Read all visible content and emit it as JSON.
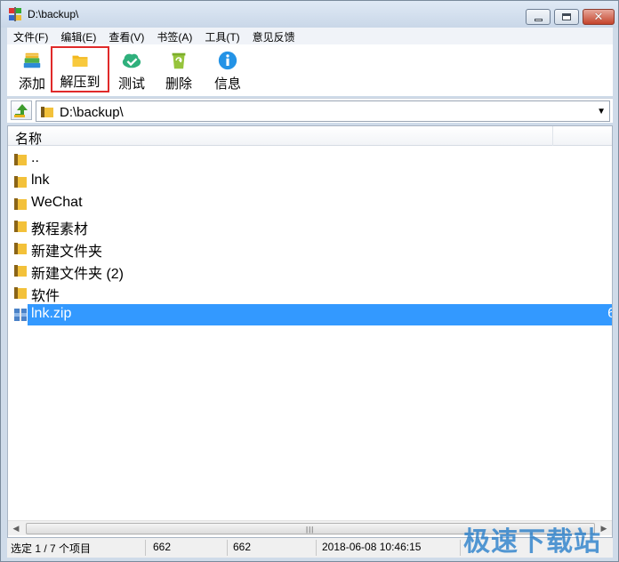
{
  "window": {
    "title": "D:\\backup\\"
  },
  "menu": {
    "items": [
      "文件(F)",
      "编辑(E)",
      "查看(V)",
      "书签(A)",
      "工具(T)",
      "意见反馈"
    ]
  },
  "toolbar": {
    "buttons": [
      {
        "label": "添加",
        "icon": "add-books-icon"
      },
      {
        "label": "解压到",
        "icon": "folder-icon",
        "highlighted": true
      },
      {
        "label": "测试",
        "icon": "cloud-check-icon"
      },
      {
        "label": "删除",
        "icon": "recycle-bin-icon"
      },
      {
        "label": "信息",
        "icon": "info-icon"
      }
    ]
  },
  "address": {
    "path": "D:\\backup\\"
  },
  "list": {
    "columns": {
      "name": "名称"
    },
    "rows": [
      {
        "name": "..",
        "type": "folder"
      },
      {
        "name": "lnk",
        "type": "folder"
      },
      {
        "name": "WeChat",
        "type": "folder"
      },
      {
        "name": "教程素材",
        "type": "folder"
      },
      {
        "name": "新建文件夹",
        "type": "folder"
      },
      {
        "name": "新建文件夹 (2)",
        "type": "folder"
      },
      {
        "name": "软件",
        "type": "folder"
      },
      {
        "name": "lnk.zip",
        "type": "archive",
        "selected": true,
        "trail": "6"
      }
    ]
  },
  "status": {
    "selection": "选定 1 / 7 个项目",
    "size": "662",
    "packed": "662",
    "modified": "2018-06-08 10:46:15"
  },
  "watermark": {
    "text": "极速下载站"
  },
  "colors": {
    "selection": "#3399ff",
    "highlight_border": "#e02a2a"
  }
}
